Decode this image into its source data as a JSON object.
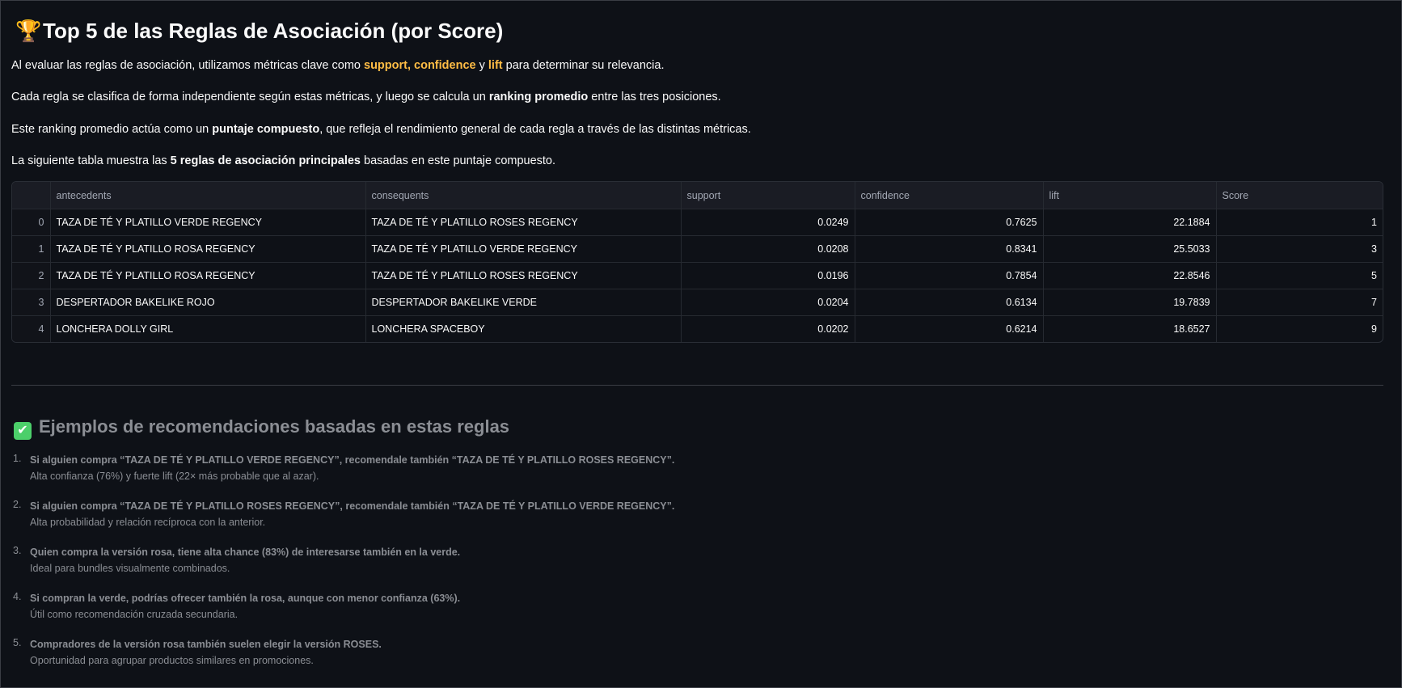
{
  "header": {
    "emoji": "🏆",
    "title": "Top 5 de las Reglas de Asociación (por Score)"
  },
  "intro": {
    "p1_before": "Al evaluar las reglas de asociación, utilizamos métricas clave como ",
    "p1_support": "support",
    "p1_comma": ", ",
    "p1_confidence": "confidence",
    "p1_y": " y ",
    "p1_lift": "lift",
    "p1_after": " para determinar su relevancia.",
    "p2_before": "Cada regla se clasifica de forma independiente según estas métricas, y luego se calcula un ",
    "p2_bold": "ranking promedio",
    "p2_after": " entre las tres posiciones.",
    "p3_before": "Este ranking promedio actúa como un ",
    "p3_bold": "puntaje compuesto",
    "p3_after": ", que refleja el rendimiento general de cada regla a través de las distintas métricas.",
    "p4_before": "La siguiente tabla muestra las ",
    "p4_bold": "5 reglas de asociación principales",
    "p4_after": " basadas en este puntaje compuesto."
  },
  "table": {
    "columns": [
      "",
      "antecedents",
      "consequents",
      "support",
      "confidence",
      "lift",
      "Score"
    ],
    "rows": [
      {
        "index": "0",
        "antecedents": "TAZA DE TÉ Y PLATILLO VERDE REGENCY",
        "consequents": "TAZA DE TÉ Y PLATILLO ROSES REGENCY",
        "support": "0.0249",
        "confidence": "0.7625",
        "lift": "22.1884",
        "score": "1"
      },
      {
        "index": "1",
        "antecedents": "TAZA DE TÉ Y PLATILLO ROSA REGENCY",
        "consequents": "TAZA DE TÉ Y PLATILLO VERDE REGENCY",
        "support": "0.0208",
        "confidence": "0.8341",
        "lift": "25.5033",
        "score": "3"
      },
      {
        "index": "2",
        "antecedents": "TAZA DE TÉ Y PLATILLO ROSA REGENCY",
        "consequents": "TAZA DE TÉ Y PLATILLO ROSES REGENCY",
        "support": "0.0196",
        "confidence": "0.7854",
        "lift": "22.8546",
        "score": "5"
      },
      {
        "index": "3",
        "antecedents": "DESPERTADOR BAKELIKE ROJO",
        "consequents": "DESPERTADOR BAKELIKE VERDE",
        "support": "0.0204",
        "confidence": "0.6134",
        "lift": "19.7839",
        "score": "7"
      },
      {
        "index": "4",
        "antecedents": "LONCHERA DOLLY GIRL",
        "consequents": "LONCHERA SPACEBOY",
        "support": "0.0202",
        "confidence": "0.6214",
        "lift": "18.6527",
        "score": "9"
      }
    ]
  },
  "examples": {
    "icon": "check-mark-icon",
    "title": "Ejemplos de recomendaciones basadas en estas reglas",
    "items": [
      {
        "number": "1.",
        "main": "Si alguien compra “TAZA DE TÉ Y PLATILLO VERDE REGENCY”, recomendale también “TAZA DE TÉ Y PLATILLO ROSES REGENCY”.",
        "sub": "Alta confianza (76%) y fuerte lift (22× más probable que al azar)."
      },
      {
        "number": "2.",
        "main": "Si alguien compra “TAZA DE TÉ Y PLATILLO ROSES REGENCY”, recomendale también “TAZA DE TÉ Y PLATILLO VERDE REGENCY”.",
        "sub": "Alta probabilidad y relación recíproca con la anterior."
      },
      {
        "number": "3.",
        "main": "Quien compra la versión rosa, tiene alta chance (83%) de interesarse también en la verde.",
        "sub": "Ideal para bundles visualmente combinados."
      },
      {
        "number": "4.",
        "main": "Si compran la verde, podrías ofrecer también la rosa, aunque con menor confianza (63%).",
        "sub": "Útil como recomendación cruzada secundaria."
      },
      {
        "number": "5.",
        "main": "Compradores de la versión rosa también suelen elegir la versión ROSES.",
        "sub": "Oportunidad para agrupar productos similares en promociones."
      }
    ]
  },
  "colors": {
    "background": "#0e1117",
    "accent_orange": "#ffbd45",
    "check_green": "#4ccf6a",
    "muted_text": "#8b8e94"
  }
}
